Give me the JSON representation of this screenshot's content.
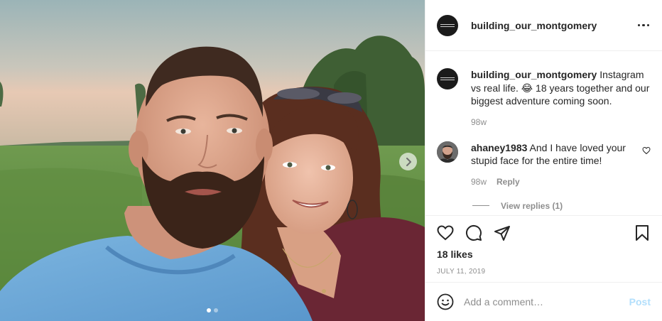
{
  "post": {
    "username": "building_our_montgomery",
    "caption": {
      "username": "building_our_montgomery",
      "text": "Instagram vs real life. 😂 18 years together and our biggest adventure coming soon.",
      "time": "98w"
    },
    "comments": [
      {
        "username": "ahaney1983",
        "text": "And I have loved your stupid face for the entire time!",
        "time": "98w",
        "reply_label": "Reply",
        "view_replies_label": "View replies (1)"
      }
    ],
    "likes": "18 likes",
    "date": "JULY 11, 2019",
    "add_comment_placeholder": "Add a comment…",
    "post_label": "Post",
    "carousel": {
      "slide_count": 2,
      "current_index": 0
    }
  },
  "colors": {
    "text": "#262626",
    "secondary": "#8e8e8e",
    "post_button_disabled": "#b2dffc",
    "divider": "#efefef"
  },
  "icons": {
    "more": "more-options-icon",
    "like": "heart-icon",
    "comment": "comment-bubble-icon",
    "share": "paper-plane-icon",
    "save": "bookmark-icon",
    "emoji": "emoji-face-icon",
    "next": "chevron-right-icon"
  }
}
